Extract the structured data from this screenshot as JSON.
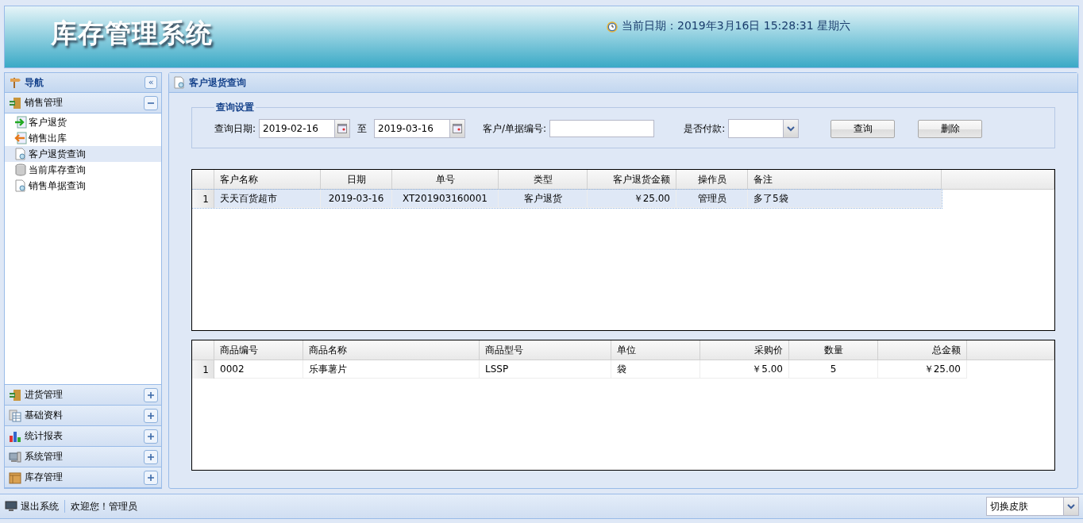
{
  "header": {
    "title": "库存管理系统",
    "datetime": "当前日期：2019年3月16日 15:28:31 星期六"
  },
  "nav": {
    "title": "导航",
    "collapse": "«",
    "sections": [
      {
        "label": "销售管理",
        "expanded": true,
        "items": [
          {
            "label": "客户退货",
            "selected": false
          },
          {
            "label": "销售出库",
            "selected": false
          },
          {
            "label": "客户退货查询",
            "selected": true
          },
          {
            "label": "当前库存查询",
            "selected": false
          },
          {
            "label": "销售单据查询",
            "selected": false
          }
        ]
      },
      {
        "label": "进货管理",
        "expanded": false
      },
      {
        "label": "基础资料",
        "expanded": false
      },
      {
        "label": "统计报表",
        "expanded": false
      },
      {
        "label": "系统管理",
        "expanded": false
      },
      {
        "label": "库存管理",
        "expanded": false
      }
    ]
  },
  "panel": {
    "title": "客户退货查询"
  },
  "query": {
    "legend": "查询设置",
    "date_label": "查询日期:",
    "date_from": "2019-02-16",
    "to_label": "至",
    "date_to": "2019-03-16",
    "customer_label": "客户/单据编号:",
    "paid_label": "是否付款:",
    "buttons": [
      "查询",
      "删除"
    ]
  },
  "orders": {
    "columns": [
      "客户名称",
      "日期",
      "单号",
      "类型",
      "客户退货金额",
      "操作员",
      "备注"
    ],
    "rows": [
      {
        "num": "1",
        "selected": true,
        "cells": [
          "天天百货超市",
          "2019-03-16",
          "XT201903160001",
          "客户退货",
          "￥25.00",
          "管理员",
          "多了5袋"
        ]
      }
    ]
  },
  "items": {
    "columns": [
      "商品编号",
      "商品名称",
      "商品型号",
      "单位",
      "采购价",
      "数量",
      "总金额"
    ],
    "rows": [
      {
        "num": "1",
        "selected": false,
        "cells": [
          "0002",
          "乐事薯片",
          "LSSP",
          "袋",
          "￥5.00",
          "5",
          "￥25.00"
        ]
      }
    ]
  },
  "footer": {
    "logout": "退出系统",
    "welcome": "欢迎您！管理员",
    "skin": "切换皮肤"
  }
}
